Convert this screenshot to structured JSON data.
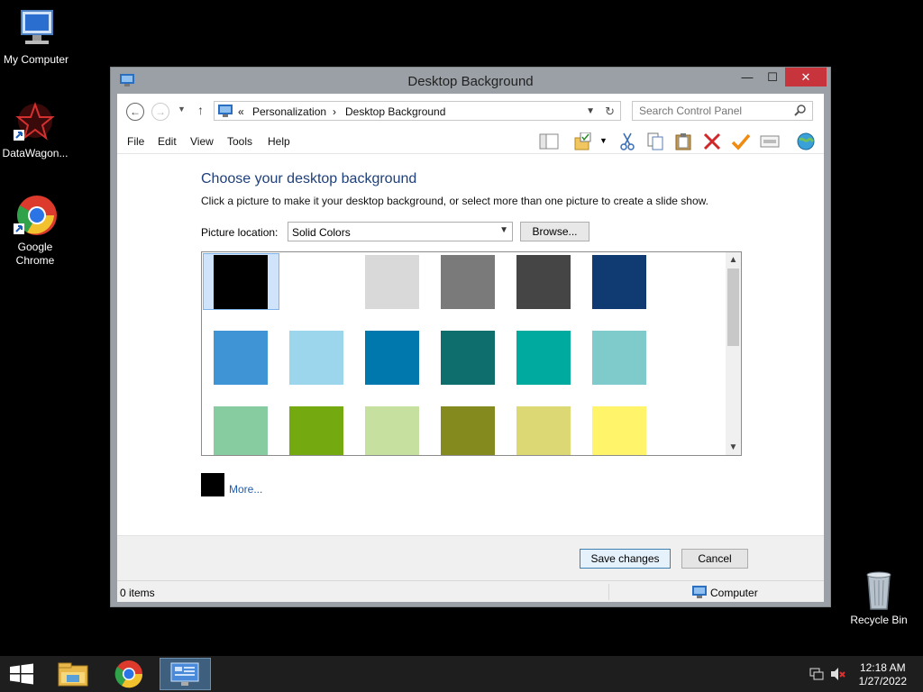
{
  "desktop": {
    "icons": [
      {
        "label": "My Computer"
      },
      {
        "label": "DataWagon..."
      },
      {
        "label": "Google Chrome"
      },
      {
        "label": "Recycle Bin"
      }
    ]
  },
  "window": {
    "title": "Desktop Background",
    "minimize": "—",
    "maximize": "☐",
    "close": "✕",
    "address": {
      "back": "←",
      "forward": "→",
      "up": "↑",
      "chevrons": "«",
      "crumb1": "Personalization",
      "sep": "›",
      "crumb2": "Desktop Background"
    },
    "search": {
      "placeholder": "Search Control Panel"
    },
    "menu": [
      "File",
      "Edit",
      "View",
      "Tools",
      "Help"
    ],
    "heading": "Choose your desktop background",
    "subtext": "Click a picture to make it your desktop background, or select more than one picture to create a slide show.",
    "location_label": "Picture location:",
    "location_value": "Solid Colors",
    "browse_label": "Browse...",
    "more_label": "More...",
    "save_label": "Save changes",
    "cancel_label": "Cancel",
    "status_left": "0 items",
    "status_right": "Computer"
  },
  "swatches": [
    "#000000",
    "#ffffff",
    "#d9d9d9",
    "#7a7a7a",
    "#454545",
    "#0f3a72",
    "#3f94d6",
    "#9cd6ec",
    "#0078ad",
    "#0e6e6e",
    "#00aa9e",
    "#7fcaca",
    "#86cca0",
    "#74aa10",
    "#c6e0a0",
    "#848a1e",
    "#dcd874",
    "#fff46a"
  ],
  "clock": {
    "time": "12:18 AM",
    "date": "1/27/2022"
  },
  "colors": {
    "accent": "#1e3f7a",
    "close_red": "#c7343c"
  }
}
